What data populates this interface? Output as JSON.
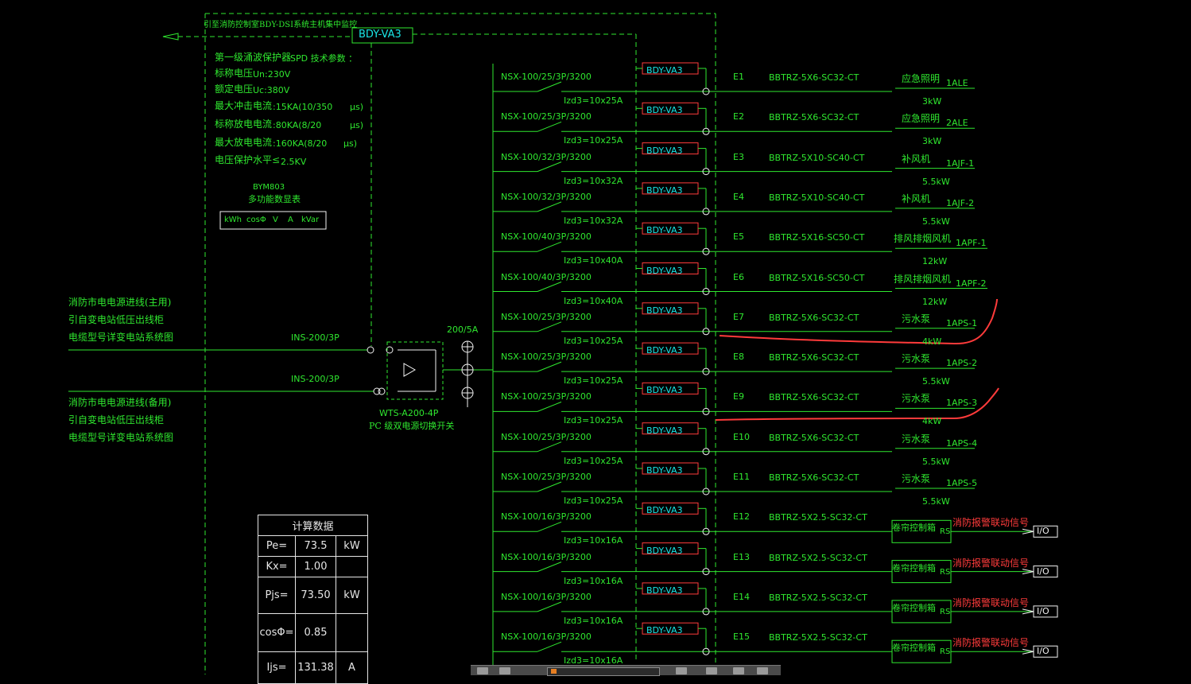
{
  "spd": {
    "top_note": "引至消防控制室BDY-DSI系统主机集中监控",
    "main_monitor": "BDY-VA3",
    "title": "第一级涌波保护器",
    "title_tail": "SPD 技术参数 ：",
    "params": [
      {
        "label": "标称电压",
        "value": "Un:230V"
      },
      {
        "label": "额定电压",
        "value": "Uc:380V"
      },
      {
        "label": "最大冲击电流",
        "value": ":15KA(10/350",
        "unit": "μs)"
      },
      {
        "label": "标称放电电流",
        "value": ":80KA(8/20",
        "unit": "μs)"
      },
      {
        "label": "最大放电电流",
        "value": ":160KA(8/20",
        "unit": "μs)"
      },
      {
        "label": "电压保护水平≤",
        "value": "2.5KV"
      }
    ]
  },
  "meter": {
    "model": "BYM803",
    "name": "多功能数显表",
    "readings": [
      "kWh",
      "cosΦ",
      "V",
      "A",
      "kVar"
    ]
  },
  "incoming": {
    "main_label": [
      "消防市电电源进线(主用)",
      "引自变电站低压出线柜",
      "电缆型号详变电站系统图"
    ],
    "backup_label": [
      "消防市电电源进线(备用)",
      "引自变电站低压出线柜",
      "电缆型号详变电站系统图"
    ],
    "breaker1": "INS-200/3P",
    "breaker2": "INS-200/3P",
    "ct": "200/5A",
    "ats_model": "WTS-A200-4P",
    "ats_desc": "PC 级双电源切换开关"
  },
  "circuits": [
    {
      "breaker": "NSX-100/25/3P/3200",
      "setting": "Izd3=10x25A",
      "monitor": "BDY-VA3",
      "id": "E1",
      "cable": "BBTRZ-5X6-SC32-CT",
      "load": "应急照明",
      "code": "1ALE",
      "power": "3kW"
    },
    {
      "breaker": "NSX-100/25/3P/3200",
      "setting": "Izd3=10x25A",
      "monitor": "BDY-VA3",
      "id": "E2",
      "cable": "BBTRZ-5X6-SC32-CT",
      "load": "应急照明",
      "code": "2ALE",
      "power": "3kW"
    },
    {
      "breaker": "NSX-100/32/3P/3200",
      "setting": "Izd3=10x32A",
      "monitor": "BDY-VA3",
      "id": "E3",
      "cable": "BBTRZ-5X10-SC40-CT",
      "load": "补风机",
      "code": "1AJF-1",
      "power": "5.5kW"
    },
    {
      "breaker": "NSX-100/32/3P/3200",
      "setting": "Izd3=10x32A",
      "monitor": "BDY-VA3",
      "id": "E4",
      "cable": "BBTRZ-5X10-SC40-CT",
      "load": "补风机",
      "code": "1AJF-2",
      "power": "5.5kW"
    },
    {
      "breaker": "NSX-100/40/3P/3200",
      "setting": "Izd3=10x40A",
      "monitor": "BDY-VA3",
      "id": "E5",
      "cable": "BBTRZ-5X16-SC50-CT",
      "load": "排风排烟风机",
      "code": "1APF-1",
      "power": "12kW"
    },
    {
      "breaker": "NSX-100/40/3P/3200",
      "setting": "Izd3=10x40A",
      "monitor": "BDY-VA3",
      "id": "E6",
      "cable": "BBTRZ-5X16-SC50-CT",
      "load": "排风排烟风机",
      "code": "1APF-2",
      "power": "12kW"
    },
    {
      "breaker": "NSX-100/25/3P/3200",
      "setting": "Izd3=10x25A",
      "monitor": "BDY-VA3",
      "id": "E7",
      "cable": "BBTRZ-5X6-SC32-CT",
      "load": "污水泵",
      "code": "1APS-1",
      "power": "4kW"
    },
    {
      "breaker": "NSX-100/25/3P/3200",
      "setting": "Izd3=10x25A",
      "monitor": "BDY-VA3",
      "id": "E8",
      "cable": "BBTRZ-5X6-SC32-CT",
      "load": "污水泵",
      "code": "1APS-2",
      "power": "5.5kW"
    },
    {
      "breaker": "NSX-100/25/3P/3200",
      "setting": "Izd3=10x25A",
      "monitor": "BDY-VA3",
      "id": "E9",
      "cable": "BBTRZ-5X6-SC32-CT",
      "load": "污水泵",
      "code": "1APS-3",
      "power": "4kW"
    },
    {
      "breaker": "NSX-100/25/3P/3200",
      "setting": "Izd3=10x25A",
      "monitor": "BDY-VA3",
      "id": "E10",
      "cable": "BBTRZ-5X6-SC32-CT",
      "load": "污水泵",
      "code": "1APS-4",
      "power": "5.5kW"
    },
    {
      "breaker": "NSX-100/25/3P/3200",
      "setting": "Izd3=10x25A",
      "monitor": "BDY-VA3",
      "id": "E11",
      "cable": "BBTRZ-5X6-SC32-CT",
      "load": "污水泵",
      "code": "1APS-5",
      "power": "5.5kW"
    },
    {
      "breaker": "NSX-100/16/3P/3200",
      "setting": "Izd3=10x16A",
      "monitor": "BDY-VA3",
      "id": "E12",
      "cable": "BBTRZ-5X2.5-SC32-CT",
      "load": "卷帘控制箱",
      "code": "RS",
      "power": "",
      "signal": "消防报警联动信号",
      "io": "I/O"
    },
    {
      "breaker": "NSX-100/16/3P/3200",
      "setting": "Izd3=10x16A",
      "monitor": "BDY-VA3",
      "id": "E13",
      "cable": "BBTRZ-5X2.5-SC32-CT",
      "load": "卷帘控制箱",
      "code": "RS",
      "power": "",
      "signal": "消防报警联动信号",
      "io": "I/O"
    },
    {
      "breaker": "NSX-100/16/3P/3200",
      "setting": "Izd3=10x16A",
      "monitor": "BDY-VA3",
      "id": "E14",
      "cable": "BBTRZ-5X2.5-SC32-CT",
      "load": "卷帘控制箱",
      "code": "RS",
      "power": "",
      "signal": "消防报警联动信号",
      "io": "I/O"
    },
    {
      "breaker": "NSX-100/16/3P/3200",
      "setting": "Izd3=10x16A",
      "monitor": "BDY-VA3",
      "id": "E15",
      "cable": "BBTRZ-5X2.5-SC32-CT",
      "load": "卷帘控制箱",
      "code": "RS",
      "power": "",
      "signal": "消防报警联动信号",
      "io": "I/O"
    }
  ],
  "calc": {
    "title": "计算数据",
    "rows": [
      {
        "k": "Pe=",
        "v": "73.5",
        "u": "kW"
      },
      {
        "k": "Kx=",
        "v": "1.00",
        "u": ""
      },
      {
        "k": "Pjs=",
        "v": "73.50",
        "u": "kW"
      },
      {
        "k": "cosΦ=",
        "v": "0.85",
        "u": ""
      },
      {
        "k": "Ijs=",
        "v": "131.38",
        "u": "A"
      }
    ]
  },
  "colors": {
    "line": "#2fe82f",
    "cyan": "#19e6e6",
    "red": "#ff3b3b",
    "white": "#f2f2f2"
  }
}
